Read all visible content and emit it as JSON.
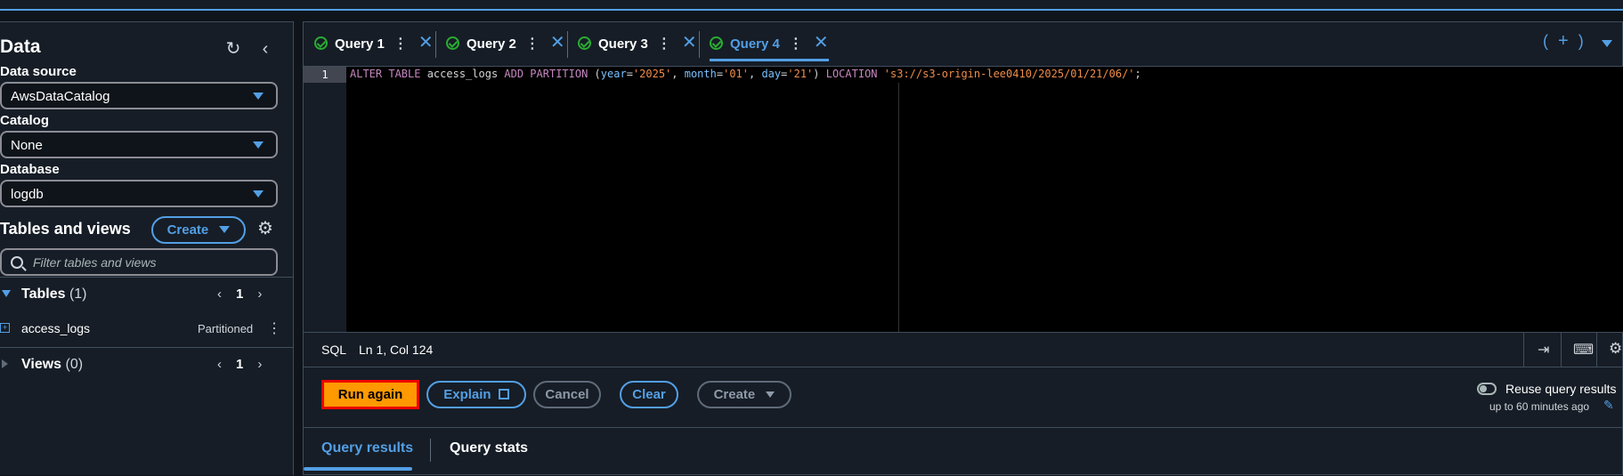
{
  "sidebar": {
    "title": "Data",
    "data_source_label": "Data source",
    "data_source_value": "AwsDataCatalog",
    "catalog_label": "Catalog",
    "catalog_value": "None",
    "database_label": "Database",
    "database_value": "logdb",
    "tables_views_title": "Tables and views",
    "create_label": "Create",
    "filter_placeholder": "Filter tables and views",
    "tables_label": "Tables",
    "tables_count": "(1)",
    "tables_page": "1",
    "table_item": "access_logs",
    "table_item_badge": "Partitioned",
    "views_label": "Views",
    "views_count": "(0)",
    "views_page": "1"
  },
  "tabs": [
    {
      "label": "Query 1"
    },
    {
      "label": "Query 2"
    },
    {
      "label": "Query 3"
    },
    {
      "label": "Query 4"
    }
  ],
  "editor": {
    "line_number": "1",
    "status_lang": "SQL",
    "status_pos": "Ln 1, Col 124"
  },
  "actions": {
    "run": "Run again",
    "explain": "Explain",
    "cancel": "Cancel",
    "clear": "Clear",
    "create": "Create",
    "reuse_label": "Reuse query results",
    "reuse_sub": "up to 60 minutes ago"
  },
  "results_tabs": {
    "results": "Query results",
    "stats": "Query stats"
  },
  "colors": {
    "accent": "#539fe5",
    "success": "#29ad32",
    "run_button": "#ff9900",
    "highlight_border": "#e00"
  }
}
